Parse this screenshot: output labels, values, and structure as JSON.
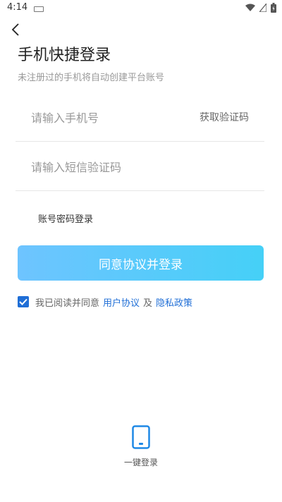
{
  "status_bar": {
    "time": "4:14"
  },
  "header": {
    "title": "手机快捷登录",
    "subtitle": "未注册过的手机将自动创建平台账号"
  },
  "phone_field": {
    "placeholder": "请输入手机号",
    "value": ""
  },
  "code_field": {
    "placeholder": "请输入短信验证码",
    "value": ""
  },
  "get_code_label": "获取验证码",
  "account_login_label": "账号密码登录",
  "login_button_label": "同意协议并登录",
  "agreement": {
    "checked": true,
    "prefix": "我已阅读并同意",
    "user_agreement": "用户协议",
    "and": "及",
    "privacy_policy": "隐私政策"
  },
  "quick_login": {
    "label": "一键登录",
    "icon": "phone-icon"
  },
  "colors": {
    "accent": "#1f6ed6",
    "button_start": "#6ec4ff",
    "button_end": "#45d0f7"
  }
}
